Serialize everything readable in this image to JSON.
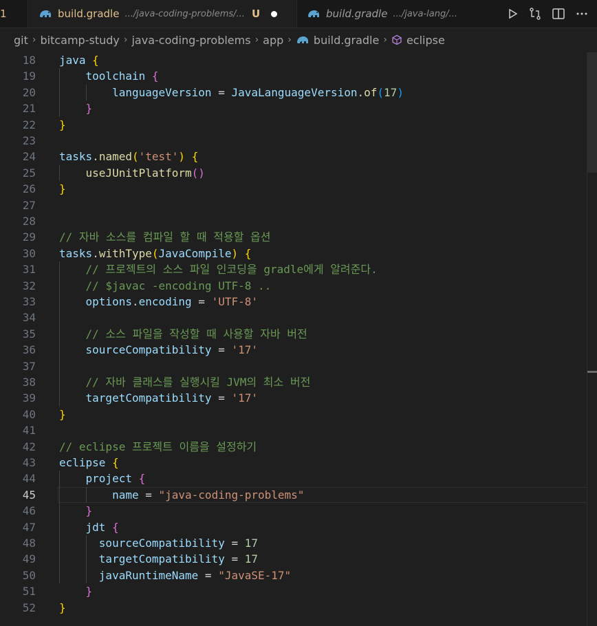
{
  "tabs": [
    {
      "name": "1"
    },
    {
      "name": "build.gradle",
      "path": ".../java-coding-problems/...",
      "status": "U"
    },
    {
      "name": "build.gradle",
      "path": ".../java-lang/..."
    }
  ],
  "breadcrumb": [
    "git",
    "bitcamp-study",
    "java-coding-problems",
    "app",
    "build.gradle",
    "eclipse"
  ],
  "current_line": 45,
  "lines": [
    {
      "n": "18",
      "tokens": [
        [
          "java",
          "t-id"
        ],
        [
          " ",
          ""
        ],
        [
          "{",
          "t-b1"
        ]
      ]
    },
    {
      "n": "19",
      "tokens": [
        [
          "    ",
          ""
        ],
        [
          "toolchain",
          "t-id"
        ],
        [
          " ",
          ""
        ],
        [
          "{",
          "t-b2"
        ]
      ]
    },
    {
      "n": "20",
      "tokens": [
        [
          "        ",
          ""
        ],
        [
          "languageVersion",
          "t-id"
        ],
        [
          " = ",
          "t-op"
        ],
        [
          "JavaLanguageVersion",
          "t-id"
        ],
        [
          ".",
          ""
        ],
        [
          "of",
          "t-fn"
        ],
        [
          "(",
          "t-b3"
        ],
        [
          "17",
          "t-num"
        ],
        [
          ")",
          "t-b3"
        ]
      ]
    },
    {
      "n": "21",
      "tokens": [
        [
          "    ",
          ""
        ],
        [
          "}",
          "t-b2"
        ]
      ]
    },
    {
      "n": "22",
      "tokens": [
        [
          "}",
          "t-b1"
        ]
      ]
    },
    {
      "n": "23",
      "tokens": []
    },
    {
      "n": "24",
      "tokens": [
        [
          "tasks",
          "t-id"
        ],
        [
          ".",
          ""
        ],
        [
          "named",
          "t-fn"
        ],
        [
          "(",
          "t-b1"
        ],
        [
          "'test'",
          "t-str"
        ],
        [
          ")",
          "t-b1"
        ],
        [
          " ",
          ""
        ],
        [
          "{",
          "t-b1"
        ]
      ]
    },
    {
      "n": "25",
      "tokens": [
        [
          "    ",
          ""
        ],
        [
          "useJUnitPlatform",
          "t-fn"
        ],
        [
          "()",
          "t-b2"
        ]
      ]
    },
    {
      "n": "26",
      "tokens": [
        [
          "}",
          "t-b1"
        ]
      ]
    },
    {
      "n": "27",
      "tokens": []
    },
    {
      "n": "28",
      "tokens": []
    },
    {
      "n": "29",
      "tokens": [
        [
          "// 자바 소스를 컴파일 할 때 적용할 옵션",
          "t-cm"
        ]
      ]
    },
    {
      "n": "30",
      "tokens": [
        [
          "tasks",
          "t-id"
        ],
        [
          ".",
          ""
        ],
        [
          "withType",
          "t-fn"
        ],
        [
          "(",
          "t-b1"
        ],
        [
          "JavaCompile",
          "t-id"
        ],
        [
          ")",
          "t-b1"
        ],
        [
          " ",
          ""
        ],
        [
          "{",
          "t-b1"
        ]
      ]
    },
    {
      "n": "31",
      "tokens": [
        [
          "    ",
          ""
        ],
        [
          "// 프로젝트의 소스 파일 인코딩을 gradle에게 알려준다.",
          "t-cm"
        ]
      ]
    },
    {
      "n": "32",
      "tokens": [
        [
          "    ",
          ""
        ],
        [
          "// $javac -encoding UTF-8 ..",
          "t-cm"
        ]
      ]
    },
    {
      "n": "33",
      "tokens": [
        [
          "    ",
          ""
        ],
        [
          "options",
          "t-id"
        ],
        [
          ".",
          ""
        ],
        [
          "encoding",
          "t-id"
        ],
        [
          " = ",
          "t-op"
        ],
        [
          "'UTF-8'",
          "t-str"
        ]
      ]
    },
    {
      "n": "34",
      "tokens": []
    },
    {
      "n": "35",
      "tokens": [
        [
          "    ",
          ""
        ],
        [
          "// 소스 파일을 작성할 때 사용할 자바 버전",
          "t-cm"
        ]
      ]
    },
    {
      "n": "36",
      "tokens": [
        [
          "    ",
          ""
        ],
        [
          "sourceCompatibility",
          "t-id"
        ],
        [
          " = ",
          "t-op"
        ],
        [
          "'17'",
          "t-str"
        ]
      ]
    },
    {
      "n": "37",
      "tokens": []
    },
    {
      "n": "38",
      "tokens": [
        [
          "    ",
          ""
        ],
        [
          "// 자바 클래스를 실행시킬 JVM의 최소 버전",
          "t-cm"
        ]
      ]
    },
    {
      "n": "39",
      "tokens": [
        [
          "    ",
          ""
        ],
        [
          "targetCompatibility",
          "t-id"
        ],
        [
          " = ",
          "t-op"
        ],
        [
          "'17'",
          "t-str"
        ]
      ]
    },
    {
      "n": "40",
      "tokens": [
        [
          "}",
          "t-b1"
        ]
      ]
    },
    {
      "n": "41",
      "tokens": []
    },
    {
      "n": "42",
      "tokens": [
        [
          "// eclipse 프로젝트 이름을 설정하기",
          "t-cm"
        ]
      ]
    },
    {
      "n": "43",
      "tokens": [
        [
          "eclipse",
          "t-id"
        ],
        [
          " ",
          ""
        ],
        [
          "{",
          "t-b1"
        ]
      ]
    },
    {
      "n": "44",
      "tokens": [
        [
          "    ",
          ""
        ],
        [
          "project",
          "t-id"
        ],
        [
          " ",
          ""
        ],
        [
          "{",
          "t-b2"
        ]
      ]
    },
    {
      "n": "45",
      "tokens": [
        [
          "        ",
          ""
        ],
        [
          "name",
          "t-id"
        ],
        [
          " = ",
          "t-op"
        ],
        [
          "\"java-coding-problems\"",
          "t-str"
        ]
      ]
    },
    {
      "n": "46",
      "tokens": [
        [
          "    ",
          ""
        ],
        [
          "}",
          "t-b2"
        ]
      ]
    },
    {
      "n": "47",
      "tokens": [
        [
          "    ",
          ""
        ],
        [
          "jdt",
          "t-id"
        ],
        [
          " ",
          ""
        ],
        [
          "{",
          "t-b2"
        ]
      ]
    },
    {
      "n": "48",
      "tokens": [
        [
          "      ",
          ""
        ],
        [
          "sourceCompatibility",
          "t-id"
        ],
        [
          " = ",
          "t-op"
        ],
        [
          "17",
          "t-num"
        ]
      ]
    },
    {
      "n": "49",
      "tokens": [
        [
          "      ",
          ""
        ],
        [
          "targetCompatibility",
          "t-id"
        ],
        [
          " = ",
          "t-op"
        ],
        [
          "17",
          "t-num"
        ]
      ]
    },
    {
      "n": "50",
      "tokens": [
        [
          "      ",
          ""
        ],
        [
          "javaRuntimeName",
          "t-id"
        ],
        [
          " = ",
          "t-op"
        ],
        [
          "\"JavaSE-17\"",
          "t-str"
        ]
      ]
    },
    {
      "n": "51",
      "tokens": [
        [
          "    ",
          ""
        ],
        [
          "}",
          "t-b2"
        ]
      ]
    },
    {
      "n": "52",
      "tokens": [
        [
          "}",
          "t-b1"
        ]
      ]
    }
  ],
  "icons": {
    "run": "run-icon",
    "compare": "compare-changes-icon",
    "split": "split-editor-icon",
    "more": "more-actions-icon"
  },
  "colors": {
    "editor_bg": "#1f1f1f",
    "tab_bg": "#181818",
    "modified": "#e2c08d",
    "comment": "#6a9955",
    "string": "#ce9178"
  }
}
